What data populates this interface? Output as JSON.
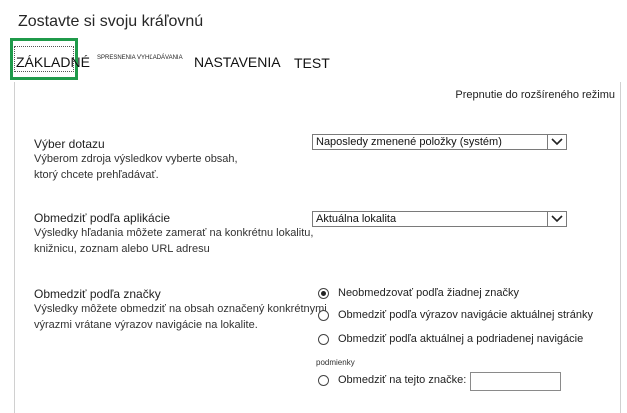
{
  "page": {
    "title": "Zostavte si svoju kráľovnú"
  },
  "tabs": [
    {
      "label": "ZÁKLADNÉ"
    },
    {
      "label": "SPRESNENIA VYHĽADÁVANIA"
    },
    {
      "label": "NASTAVENIA"
    },
    {
      "label": "TEST"
    }
  ],
  "advanced_link": "Prepnutie do rozšíreného režimu",
  "query_section": {
    "title": "Výber dotazu",
    "desc_line1": "Výberom zdroja výsledkov vyberte obsah,",
    "desc_line2": "ktorý chcete prehľadávať.",
    "select_value": "Naposledy zmenené položky (systém)"
  },
  "app_section": {
    "title": "Obmedziť podľa aplikácie",
    "desc_line1": "Výsledky hľadania môžete zamerať na konkrétnu lokalitu,",
    "desc_line2": "knižnicu, zoznam alebo URL adresu",
    "select_value": "Aktuálna lokalita"
  },
  "tag_section": {
    "title": "Obmedziť podľa značky",
    "desc_line1": "Výsledky môžete obmedziť na obsah označený konkrétnymi",
    "desc_line2": "výrazmi vrátane výrazov navigácie na lokalite.",
    "options": [
      {
        "label": "Neobmedzovať podľa žiadnej značky",
        "selected": true
      },
      {
        "label": "Obmedziť podľa výrazov navigácie aktuálnej stránky",
        "selected": false
      },
      {
        "label": "Obmedziť podľa aktuálnej a podriadenej navigácie",
        "selected": false
      }
    ],
    "conditions_label": "podmienky",
    "tag_option_label": "Obmedziť na tejto značke:",
    "tag_input_value": ""
  },
  "colors": {
    "highlight": "#1f9a4a"
  }
}
